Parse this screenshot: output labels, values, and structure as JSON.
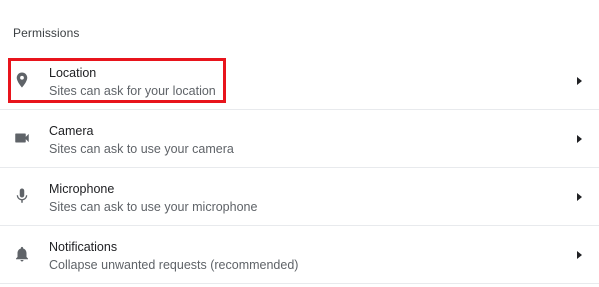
{
  "section": {
    "title": "Permissions"
  },
  "permissions": [
    {
      "title": "Location",
      "subtitle": "Sites can ask for your location",
      "icon": "location-pin-icon"
    },
    {
      "title": "Camera",
      "subtitle": "Sites can ask to use your camera",
      "icon": "camera-icon"
    },
    {
      "title": "Microphone",
      "subtitle": "Sites can ask to use your microphone",
      "icon": "microphone-icon"
    },
    {
      "title": "Notifications",
      "subtitle": "Collapse unwanted requests (recommended)",
      "icon": "bell-icon"
    }
  ],
  "colors": {
    "highlight_border": "#e8141c",
    "icon": "#5f6368",
    "divider": "#e8eaed"
  }
}
